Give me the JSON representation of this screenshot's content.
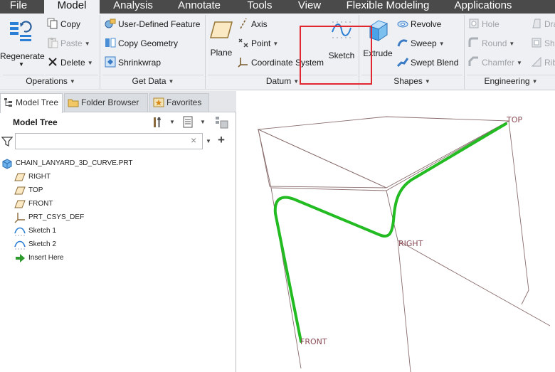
{
  "tabs": [
    "File",
    "Model",
    "Analysis",
    "Annotate",
    "Tools",
    "View",
    "Flexible Modeling",
    "Applications"
  ],
  "active_tab": "Model",
  "ribbon": {
    "operations": {
      "regenerate": "Regenerate",
      "copy": "Copy",
      "paste": "Paste",
      "delete": "Delete",
      "group_label": "Operations"
    },
    "get_data": {
      "user_defined_feature": "User-Defined Feature",
      "copy_geometry": "Copy Geometry",
      "shrinkwrap": "Shrinkwrap",
      "group_label": "Get Data"
    },
    "datum": {
      "plane": "Plane",
      "axis": "Axis",
      "point": "Point",
      "coordinate_system": "Coordinate System",
      "sketch": "Sketch",
      "group_label": "Datum"
    },
    "shapes": {
      "extrude": "Extrude",
      "revolve": "Revolve",
      "sweep": "Sweep",
      "swept_blend": "Swept Blend",
      "group_label": "Shapes"
    },
    "engineering": {
      "hole": "Hole",
      "round": "Round",
      "chamfer": "Chamfer",
      "draft": "Dra",
      "shell": "She",
      "rib": "Rib",
      "group_label": "Engineering"
    }
  },
  "panel_tabs": [
    "Model Tree",
    "Folder Browser",
    "Favorites"
  ],
  "model_tree": {
    "title": "Model Tree",
    "filter_value": "",
    "items": [
      {
        "label": "CHAIN_LANYARD_3D_CURVE.PRT",
        "icon": "part-icon",
        "indent": 0
      },
      {
        "label": "RIGHT",
        "icon": "datum-plane-icon",
        "indent": 1
      },
      {
        "label": "TOP",
        "icon": "datum-plane-icon",
        "indent": 1
      },
      {
        "label": "FRONT",
        "icon": "datum-plane-icon",
        "indent": 1
      },
      {
        "label": "PRT_CSYS_DEF",
        "icon": "csys-icon",
        "indent": 1
      },
      {
        "label": "Sketch 1",
        "icon": "sketch-icon",
        "indent": 1
      },
      {
        "label": "Sketch 2",
        "icon": "sketch-icon",
        "indent": 1
      },
      {
        "label": "Insert Here",
        "icon": "insert-arrow-icon",
        "indent": 1
      }
    ]
  },
  "viewport": {
    "labels": {
      "top": "TOP",
      "right": "RIGHT",
      "front": "FRONT"
    },
    "curve_color": "#22bb22",
    "datum_color": "#8a6d6d"
  },
  "colors": {
    "tabbar_bg": "#4a4a4a",
    "ribbon_bg": "#eef0f3",
    "highlight": "#e0262e"
  }
}
